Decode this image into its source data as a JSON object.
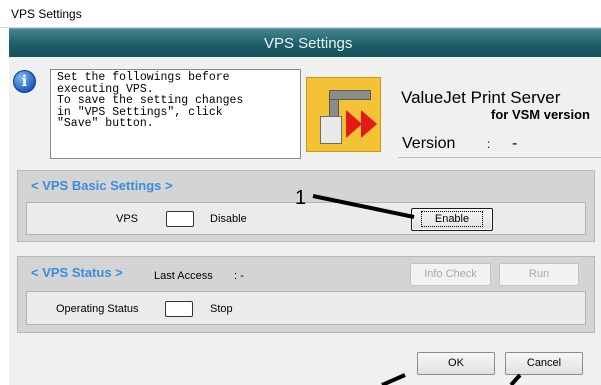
{
  "window": {
    "title": "VPS Settings"
  },
  "banner": {
    "title": "VPS Settings"
  },
  "info": {
    "icon": "info-icon",
    "text": "Set the followings before\nexecuting VPS.\nTo save the setting changes\nin \"VPS Settings\", click\n\"Save\" button."
  },
  "product": {
    "logo_icon": "valuejet-print-server-logo",
    "name": "ValueJet Print Server",
    "subtitle": "for VSM version",
    "version_label": "Version",
    "version_colon": ":",
    "version_value": "-"
  },
  "basic_settings": {
    "title": "< VPS Basic Settings >",
    "vps_label": "VPS",
    "vps_status": "Disable",
    "enable_button": "Enable"
  },
  "vps_status": {
    "title": "< VPS Status >",
    "last_access_label": "Last Access",
    "last_access_value": ":  -",
    "info_check_button": "Info Check",
    "run_button": "Run",
    "operating_status_label": "Operating Status",
    "operating_status_value": "Stop"
  },
  "footer": {
    "ok_button": "OK",
    "cancel_button": "Cancel"
  },
  "annotation": {
    "number": "1"
  },
  "colors": {
    "banner": "#1e5e69",
    "group_heading": "#3a8ddc",
    "logo": "#f3c235",
    "logo_arrow": "#e21a1a"
  }
}
